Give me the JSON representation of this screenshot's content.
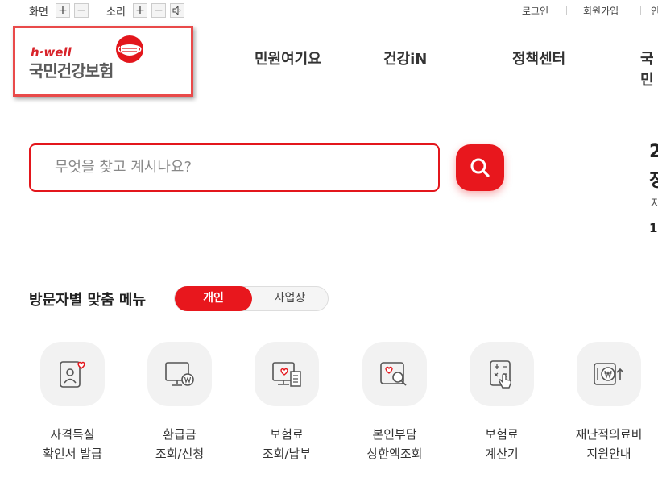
{
  "util": {
    "screen_label": "화면",
    "sound_label": "소리",
    "plus": "+",
    "minus": "−",
    "login": "로그인",
    "signup": "회원가입",
    "extra": "인"
  },
  "logo": {
    "small": "h·well",
    "main": "국민건강보험"
  },
  "nav": [
    "민원여기요",
    "건강iN",
    "정책센터",
    "국민"
  ],
  "search": {
    "placeholder": "무엇을 찾고 계시나요?"
  },
  "right_partial": {
    "line1": "2",
    "line2": "정",
    "line3": "자",
    "line4": "1"
  },
  "section": {
    "title": "방문자별 맞춤 메뉴",
    "tab_personal": "개인",
    "tab_business": "사업장"
  },
  "menu": [
    {
      "line1": "자격득실",
      "line2": "확인서 발급",
      "icon": "id-card-icon"
    },
    {
      "line1": "환급금",
      "line2": "조회/신청",
      "icon": "monitor-won-icon"
    },
    {
      "line1": "보험료",
      "line2": "조회/납부",
      "icon": "invoice-icon"
    },
    {
      "line1": "본인부담",
      "line2": "상한액조회",
      "icon": "heart-search-icon"
    },
    {
      "line1": "보험료",
      "line2": "계산기",
      "icon": "calculator-icon"
    },
    {
      "line1": "재난적의료비",
      "line2": "지원안내",
      "icon": "won-up-icon"
    }
  ],
  "colors": {
    "brand_red": "#e8171d",
    "annotation_box": "#e94a4a"
  }
}
